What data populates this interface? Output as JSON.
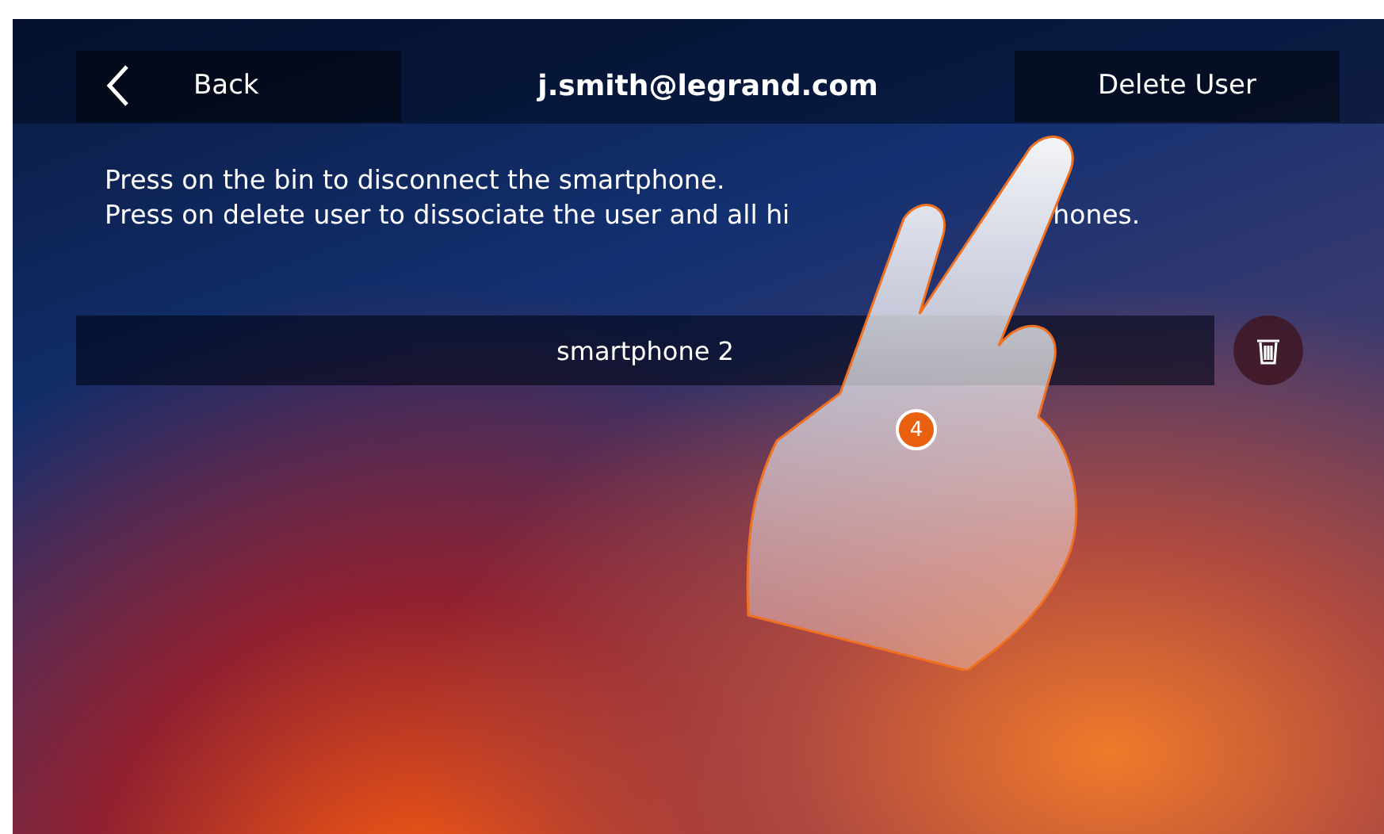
{
  "header": {
    "back_label": "Back",
    "title": "j.smith@legrand.com",
    "delete_label": "Delete User"
  },
  "instructions": [
    "Press on the bin to disconnect the smartphone.",
    {
      "before": "Press on delete user to dissociate the user and all hi",
      "after": "hones."
    }
  ],
  "devices": [
    {
      "name": "smartphone 2"
    }
  ],
  "step_badge": "4"
}
